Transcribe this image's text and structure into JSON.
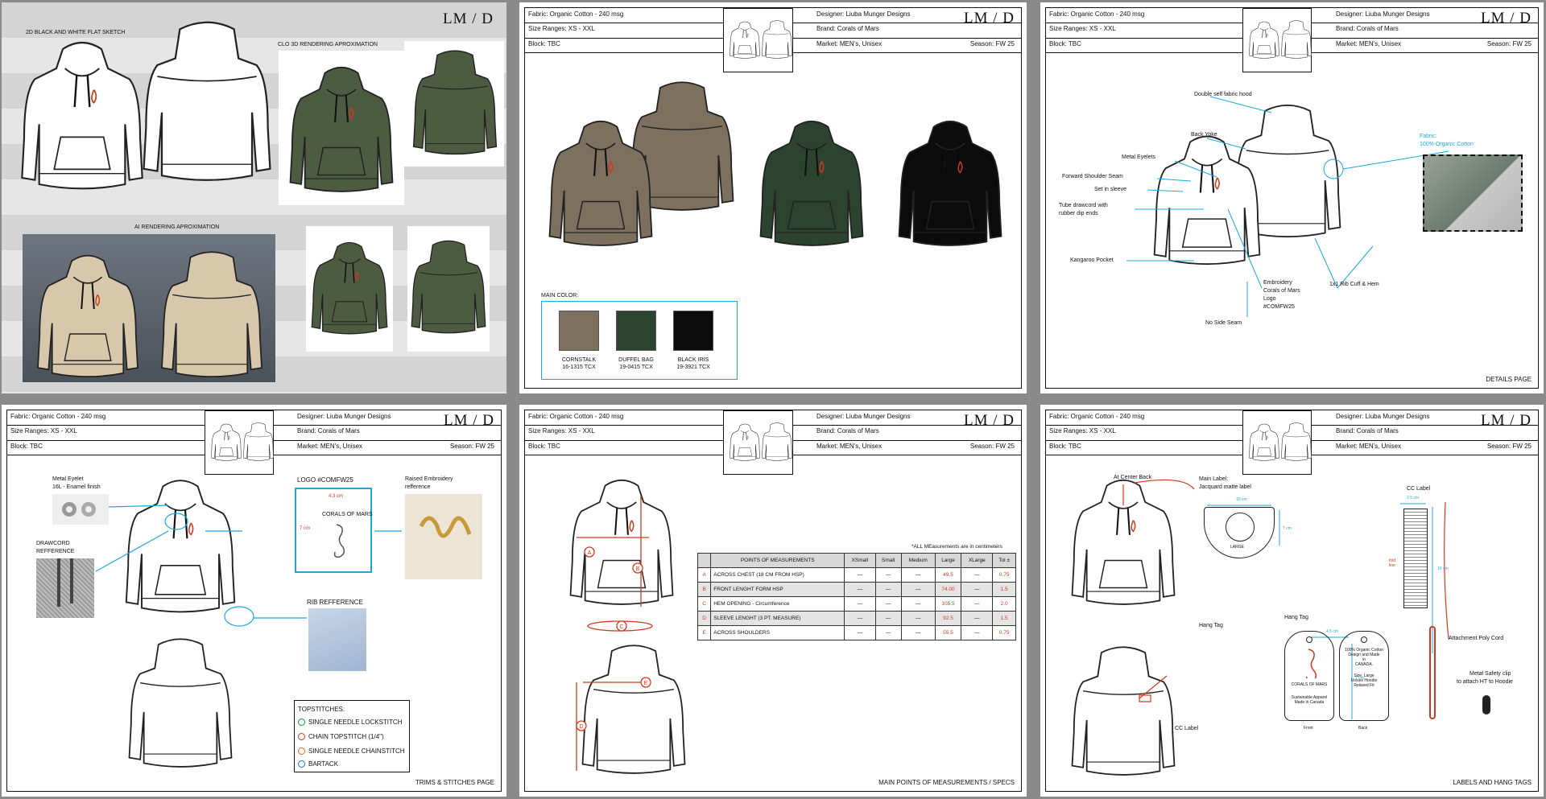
{
  "header": {
    "fabric": "Fabric: Organic Cotton - 240 msg",
    "size": "Size Ranges: XS - XXL",
    "block": "Block: TBC",
    "designer": "Designer: Liuba Munger Designs",
    "brand": "Brand: Corals of Mars",
    "market": "Market: MEN's, Unisex",
    "season": "Season: FW 25",
    "logo": "LM / D"
  },
  "page1": {
    "sketch_label": "2D BLACK AND WHITE FLAT SKETCH",
    "clo_label": "CLO 3D RENDERING APROXIMATION",
    "ai_label": "AI RENDERING APROXIMATION"
  },
  "page2": {
    "main_color_label": "MAIN COLOR:",
    "colors": [
      {
        "name": "CORNSTALK",
        "code": "16-1315 TCX",
        "hex": "#7e705e"
      },
      {
        "name": "DUFFEL BAG",
        "code": "19-0415 TCX",
        "hex": "#2c4330"
      },
      {
        "name": "BLACK IRIS",
        "code": "19-3921 TCX",
        "hex": "#0b0b0b"
      }
    ]
  },
  "page3": {
    "name": "DETAILS PAGE",
    "fabric_callout": "Fabric:",
    "fabric_callout2": "100% Organic Cotton",
    "callouts": {
      "hood": "Double self fabric hood",
      "yoke": "Back Yoke",
      "eyelets": "Metal Eyelets",
      "shoulder": "Forward Shoulder Seam",
      "sleeve": "Set in sleeve",
      "drawcord1": "Tube drawcord with",
      "drawcord2": "rubber dip ends",
      "pocket": "Kangaroo Pocket",
      "emb1": "Embroidery",
      "emb2": "Corals of Mars",
      "emb3": "Logo",
      "emb4": "#COMFW25",
      "rib": "1x1 Rib Cuff & Hem",
      "side": "No Side Seam"
    }
  },
  "page4": {
    "name": "TRIMS & STITCHES PAGE",
    "eyelet1": "Metal Eyelet",
    "eyelet2": "16L - Enamel finish",
    "drawcord1": "DRAWCORD",
    "drawcord2": "REFFERENCE",
    "logo_title": "LOGO #COMFW25",
    "logo_w": "4.3 cm",
    "logo_h": "7 cm",
    "logo_text": "CORALS OF MARS",
    "emb1": "Raised Embroidery",
    "emb2": "refference",
    "rib": "RIB REFFERENCE",
    "topstitch_title": "TOPSTITCHES:",
    "stitches": [
      {
        "label": "SINGLE NEEDLE LOCKSTITCH",
        "color": "#1a9a3a"
      },
      {
        "label": "CHAIN TOPSTITCH (1/4\")",
        "color": "#d03a1c"
      },
      {
        "label": "SINGLE NEEDLE CHAINSTITCH",
        "color": "#e06a1c"
      },
      {
        "label": "BARTACK",
        "color": "#1e6fc8"
      }
    ]
  },
  "page5": {
    "name": "MAIN POINTS OF MEASUREMENTS / SPECS",
    "note": "*ALL MEasurements are in centimeters",
    "columns": [
      "",
      "POINTS OF MEASUREMENTS",
      "XSmall",
      "Small",
      "Medium",
      "Large",
      "XLarge",
      "Tol ±"
    ],
    "rows": [
      {
        "id": "A",
        "desc": "ACROSS CHEST (18 CM FROM HSP)",
        "xs": "—",
        "s": "—",
        "m": "—",
        "l": "49.5",
        "xl": "—",
        "tol": "0.75"
      },
      {
        "id": "B",
        "desc": "FRONT LENGHT FORM HSP",
        "xs": "—",
        "s": "—",
        "m": "—",
        "l": "74.00",
        "xl": "—",
        "tol": "1.5"
      },
      {
        "id": "C",
        "desc": "HEM OPENING - Circumference",
        "xs": "—",
        "s": "—",
        "m": "—",
        "l": "105.5",
        "xl": "—",
        "tol": "2.0"
      },
      {
        "id": "D",
        "desc": "SLEEVE LENGHT (3 PT. MEASURE)",
        "xs": "—",
        "s": "—",
        "m": "—",
        "l": "92.5",
        "xl": "—",
        "tol": "1.5"
      },
      {
        "id": "E",
        "desc": "ACROSS SHOULDERS",
        "xs": "—",
        "s": "—",
        "m": "—",
        "l": "55.5",
        "xl": "—",
        "tol": "0.75"
      }
    ]
  },
  "page6": {
    "name": "LABELS AND HANG TAGS",
    "center_back": "At Center Back",
    "main_label1": "Main Label:",
    "main_label2": "Jacquard matte label",
    "main_w": "10 cm",
    "main_h": "7 cm",
    "main_size": "LARGE",
    "cc_label": "CC Label",
    "cc_w": "2.5 cm",
    "cc_h": "10 cm",
    "fold": "fold line",
    "hang_tag": "Hang Tag",
    "hang_tag2": "Hang Tag",
    "tag_w": "4.5 cm",
    "tag_h": "7 cm",
    "tag_brand": "CORALS OF MARS",
    "tag_front1": "Sustainable Apparel",
    "tag_front2": "Made in Canada",
    "tag_back1": "100% Organic Cotton",
    "tag_back2": "Design and Made",
    "tag_back3": "in",
    "tag_back4": "CANADA.",
    "tag_back5": "Size: Large",
    "tag_back6": "Unisex Hoodie",
    "tag_back7": "Relaxed Fit",
    "front": "Front",
    "back": "Back",
    "cord": "Attachment Poly Cord",
    "clip1": "Metal Safety clip",
    "clip2": "to attach HT to Hoodie",
    "cc_label2": "CC Label"
  }
}
